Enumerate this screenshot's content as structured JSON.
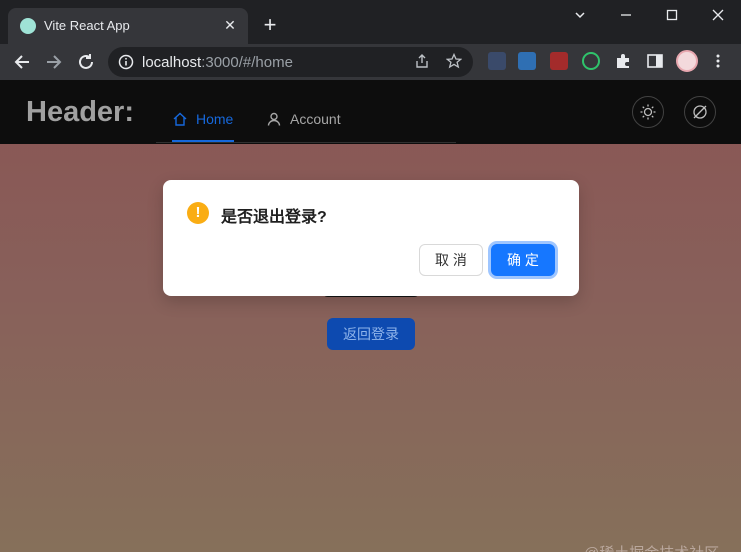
{
  "browser": {
    "tab_title": "Vite React App",
    "url_host": "localhost",
    "url_rest": ":3000/#/home"
  },
  "header": {
    "brand": "Header:",
    "menu": [
      {
        "label": "Home",
        "icon": "home-icon",
        "active": true
      },
      {
        "label": "Account",
        "icon": "user-icon",
        "active": false
      }
    ],
    "theme_icon": "sun-icon",
    "toggle_icon": "eye-off-icon"
  },
  "page": {
    "return_button": "返回登录",
    "watermark": "@稀土掘金技术社区"
  },
  "modal": {
    "title": "是否退出登录?",
    "icon": "exclamation-icon",
    "icon_glyph": "!",
    "cancel_label": "取 消",
    "ok_label": "确 定"
  },
  "colors": {
    "primary": "#1677ff",
    "warning": "#faad14",
    "menu_active": "#1668dc"
  }
}
